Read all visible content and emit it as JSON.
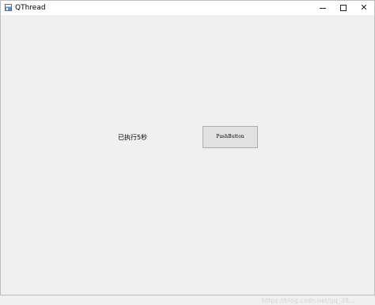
{
  "window": {
    "title": "QThread"
  },
  "controls": {
    "close_glyph": "✕"
  },
  "main": {
    "status_label": "已执行5秒",
    "push_button_label": "PushButton"
  },
  "watermark": "https://blog.csdn.net/qq_38..."
}
